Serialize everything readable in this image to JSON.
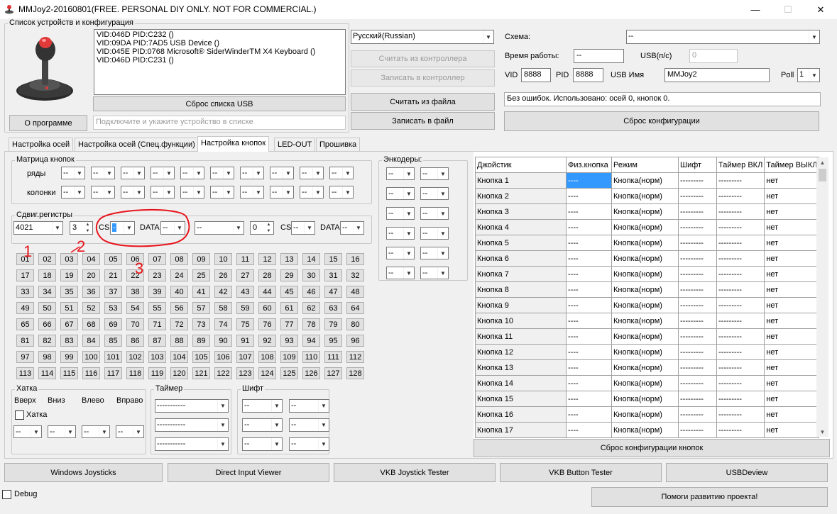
{
  "window": {
    "title": "MMJoy2-20160801(FREE. PERSONAL DIY ONLY. NOT FOR COMMERCIAL.)",
    "minimize": "—",
    "maximize": "☐",
    "close": "✕"
  },
  "devices": {
    "group_label": "Список устройств и конфигурация",
    "list": [
      "VID:046D PID:C232 ()",
      "VID:09DA PID:7AD5 USB Device ()",
      "VID:045E PID:0768 Microsoft® SiderWinderTM X4 Keyboard ()",
      "VID:046D PID:C231 ()"
    ],
    "reset_usb": "Сброс списка USB",
    "about": "О программе",
    "hint": "Подключите и укажите устройство в списке",
    "language": "Русский(Russian)",
    "read_controller": "Считать из контроллера",
    "write_controller": "Записать в контроллер",
    "read_file": "Считать из файла",
    "write_file": "Записать в файл"
  },
  "config": {
    "scheme_label": "Схема:",
    "scheme_value": "--",
    "uptime_label": "Время работы:",
    "uptime_value": "--",
    "usb_label": "USB(п/с)",
    "usb_value": "0",
    "vid_label": "VID",
    "vid_value": "8888",
    "pid_label": "PID",
    "pid_value": "8888",
    "usbname_label": "USB Имя",
    "usbname_value": "MMJoy2",
    "poll_label": "Poll",
    "poll_value": "1",
    "status": "Без ошибок. Использовано: осей  0, кнопок  0.",
    "reset_config": "Сброс конфигурации"
  },
  "tabs": [
    "Настройка осей",
    "Настройка осей (Спец.функции)",
    "Настройка кнопок",
    "LED-OUT",
    "Прошивка"
  ],
  "matrix": {
    "label": "Матрица кнопок",
    "rows_label": "ряды",
    "cols_label": "колонки",
    "combo_value": "--"
  },
  "shift": {
    "label": "Сдвиг.регистры",
    "chip1": "4021",
    "count1": "3",
    "cs": "CS",
    "data": "DATA",
    "cs1_value": "-",
    "data1_value": "--",
    "chip2": "--",
    "count2": "0",
    "cs2_value": "--",
    "data2_value": "--"
  },
  "encoders": {
    "label": "Энкодеры:",
    "combo_value": "--"
  },
  "numbers": [
    "01",
    "02",
    "03",
    "04",
    "05",
    "06",
    "07",
    "08",
    "09",
    "10",
    "11",
    "12",
    "13",
    "14",
    "15",
    "16",
    "17",
    "18",
    "19",
    "20",
    "21",
    "22",
    "23",
    "24",
    "25",
    "26",
    "27",
    "28",
    "29",
    "30",
    "31",
    "32",
    "33",
    "34",
    "35",
    "36",
    "37",
    "38",
    "39",
    "40",
    "41",
    "42",
    "43",
    "44",
    "45",
    "46",
    "47",
    "48",
    "49",
    "50",
    "51",
    "52",
    "53",
    "54",
    "55",
    "56",
    "57",
    "58",
    "59",
    "60",
    "61",
    "62",
    "63",
    "64",
    "65",
    "66",
    "67",
    "68",
    "69",
    "70",
    "71",
    "72",
    "73",
    "74",
    "75",
    "76",
    "77",
    "78",
    "79",
    "80",
    "81",
    "82",
    "83",
    "84",
    "85",
    "86",
    "87",
    "88",
    "89",
    "90",
    "91",
    "92",
    "93",
    "94",
    "95",
    "96",
    "97",
    "98",
    "99",
    "100",
    "101",
    "102",
    "103",
    "104",
    "105",
    "106",
    "107",
    "108",
    "109",
    "110",
    "111",
    "112",
    "113",
    "114",
    "115",
    "116",
    "117",
    "118",
    "119",
    "120",
    "121",
    "122",
    "123",
    "124",
    "125",
    "126",
    "127",
    "128"
  ],
  "hat": {
    "label": "Хатка",
    "up": "Вверх",
    "down": "Вниз",
    "left": "Влево",
    "right": "Вправо",
    "checkbox": "Хатка",
    "combo_value": "--"
  },
  "timer": {
    "label": "Таймер",
    "combo_value": "-----------"
  },
  "shiftgrp": {
    "label": "Шифт",
    "combo_value": "--"
  },
  "button_table": {
    "headers": [
      "Джойстик",
      "Физ.кнопка",
      "Режим",
      "Шифт",
      "Таймер ВКЛ",
      "Таймер ВЫКЛ"
    ],
    "rows": [
      [
        "Кнопка 1",
        "----",
        "Кнопка(норм)",
        "---------",
        "---------",
        "нет"
      ],
      [
        "Кнопка 2",
        "----",
        "Кнопка(норм)",
        "---------",
        "---------",
        "нет"
      ],
      [
        "Кнопка 3",
        "----",
        "Кнопка(норм)",
        "---------",
        "---------",
        "нет"
      ],
      [
        "Кнопка 4",
        "----",
        "Кнопка(норм)",
        "---------",
        "---------",
        "нет"
      ],
      [
        "Кнопка 5",
        "----",
        "Кнопка(норм)",
        "---------",
        "---------",
        "нет"
      ],
      [
        "Кнопка 6",
        "----",
        "Кнопка(норм)",
        "---------",
        "---------",
        "нет"
      ],
      [
        "Кнопка 7",
        "----",
        "Кнопка(норм)",
        "---------",
        "---------",
        "нет"
      ],
      [
        "Кнопка 8",
        "----",
        "Кнопка(норм)",
        "---------",
        "---------",
        "нет"
      ],
      [
        "Кнопка 9",
        "----",
        "Кнопка(норм)",
        "---------",
        "---------",
        "нет"
      ],
      [
        "Кнопка 10",
        "----",
        "Кнопка(норм)",
        "---------",
        "---------",
        "нет"
      ],
      [
        "Кнопка 11",
        "----",
        "Кнопка(норм)",
        "---------",
        "---------",
        "нет"
      ],
      [
        "Кнопка 12",
        "----",
        "Кнопка(норм)",
        "---------",
        "---------",
        "нет"
      ],
      [
        "Кнопка 13",
        "----",
        "Кнопка(норм)",
        "---------",
        "---------",
        "нет"
      ],
      [
        "Кнопка 14",
        "----",
        "Кнопка(норм)",
        "---------",
        "---------",
        "нет"
      ],
      [
        "Кнопка 15",
        "----",
        "Кнопка(норм)",
        "---------",
        "---------",
        "нет"
      ],
      [
        "Кнопка 16",
        "----",
        "Кнопка(норм)",
        "---------",
        "---------",
        "нет"
      ],
      [
        "Кнопка 17",
        "----",
        "Кнопка(норм)",
        "---------",
        "---------",
        "нет"
      ]
    ],
    "reset": "Сброс конфигурации кнопок"
  },
  "bottom": {
    "buttons": [
      "Windows Joysticks",
      "Direct Input Viewer",
      "VKB Joystick Tester",
      "VKB Button Tester",
      "USBDeview"
    ],
    "debug": "Debug",
    "help": "Помоги развитию проекта!"
  },
  "annotations": [
    "1",
    "2",
    "3"
  ],
  "colors": {
    "selection": "#3399ff",
    "annotation": "#e8141b"
  }
}
